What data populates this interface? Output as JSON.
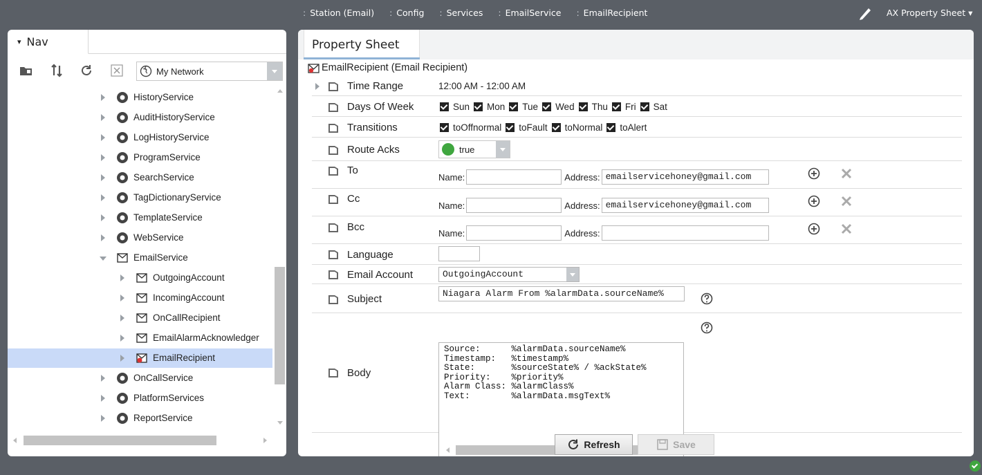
{
  "breadcrumb": [
    "Station (Email)",
    "Config",
    "Services",
    "EmailService",
    "EmailRecipient"
  ],
  "view_selector": {
    "label": "AX Property Sheet"
  },
  "nav": {
    "tab_label": "Nav",
    "network_select": "My Network",
    "tree": [
      {
        "label": "HistoryService",
        "icon": "history-service-icon",
        "level": 1,
        "state": "closed"
      },
      {
        "label": "AuditHistoryService",
        "icon": "audit-history-icon",
        "level": 1,
        "state": "closed"
      },
      {
        "label": "LogHistoryService",
        "icon": "log-history-icon",
        "level": 1,
        "state": "closed"
      },
      {
        "label": "ProgramService",
        "icon": "program-service-icon",
        "level": 1,
        "state": "closed"
      },
      {
        "label": "SearchService",
        "icon": "search-service-icon",
        "level": 1,
        "state": "closed"
      },
      {
        "label": "TagDictionaryService",
        "icon": "tag-dictionary-icon",
        "level": 1,
        "state": "closed"
      },
      {
        "label": "TemplateService",
        "icon": "template-service-icon",
        "level": 1,
        "state": "closed"
      },
      {
        "label": "WebService",
        "icon": "web-service-icon",
        "level": 1,
        "state": "closed"
      },
      {
        "label": "EmailService",
        "icon": "email-service-icon",
        "level": 1,
        "state": "open"
      },
      {
        "label": "OutgoingAccount",
        "icon": "outgoing-account-icon",
        "level": 2,
        "state": "closed"
      },
      {
        "label": "IncomingAccount",
        "icon": "incoming-account-icon",
        "level": 2,
        "state": "closed"
      },
      {
        "label": "OnCallRecipient",
        "icon": "oncall-recipient-icon",
        "level": 2,
        "state": "closed"
      },
      {
        "label": "EmailAlarmAcknowledger",
        "icon": "alarm-acknowledger-icon",
        "level": 2,
        "state": "closed"
      },
      {
        "label": "EmailRecipient",
        "icon": "email-recipient-icon",
        "level": 2,
        "state": "closed",
        "selected": true
      },
      {
        "label": "OnCallService",
        "icon": "oncall-service-icon",
        "level": 1,
        "state": "closed"
      },
      {
        "label": "PlatformServices",
        "icon": "platform-services-icon",
        "level": 1,
        "state": "closed"
      },
      {
        "label": "ReportService",
        "icon": "report-service-icon",
        "level": 1,
        "state": "closed"
      }
    ]
  },
  "sheet": {
    "tab_label": "Property Sheet",
    "header": "EmailRecipient  (Email Recipient)",
    "time_range": {
      "label": "Time Range",
      "value": "12:00 AM - 12:00 AM"
    },
    "days_of_week": {
      "label": "Days Of Week",
      "days": [
        "Sun",
        "Mon",
        "Tue",
        "Wed",
        "Thu",
        "Fri",
        "Sat"
      ]
    },
    "transitions": {
      "label": "Transitions",
      "items": [
        "toOffnormal",
        "toFault",
        "toNormal",
        "toAlert"
      ]
    },
    "route_acks": {
      "label": "Route Acks",
      "value": "true"
    },
    "to": {
      "label": "To",
      "name_label": "Name:",
      "name": "",
      "address_label": "Address:",
      "address": "emailservicehoney@gmail.com"
    },
    "cc": {
      "label": "Cc",
      "name_label": "Name:",
      "name": "",
      "address_label": "Address:",
      "address": "emailservicehoney@gmail.com"
    },
    "bcc": {
      "label": "Bcc",
      "name_label": "Name:",
      "name": "",
      "address_label": "Address:",
      "address": ""
    },
    "language": {
      "label": "Language",
      "value": ""
    },
    "email_account": {
      "label": "Email Account",
      "value": "OutgoingAccount"
    },
    "subject": {
      "label": "Subject",
      "value": "Niagara Alarm From %alarmData.sourceName%"
    },
    "body": {
      "label": "Body",
      "value": "Source:      %alarmData.sourceName%\nTimestamp:   %timestamp%\nState:       %sourceState% / %ackState%\nPriority:    %priority%\nAlarm Class: %alarmClass%\nText:        %alarmData.msgText%"
    }
  },
  "buttons": {
    "refresh": "Refresh",
    "save": "Save"
  },
  "colors": {
    "selection": "#c9daf8",
    "route_acks_true": "#3fa63f",
    "tab_underline": "#8fb2d6"
  }
}
